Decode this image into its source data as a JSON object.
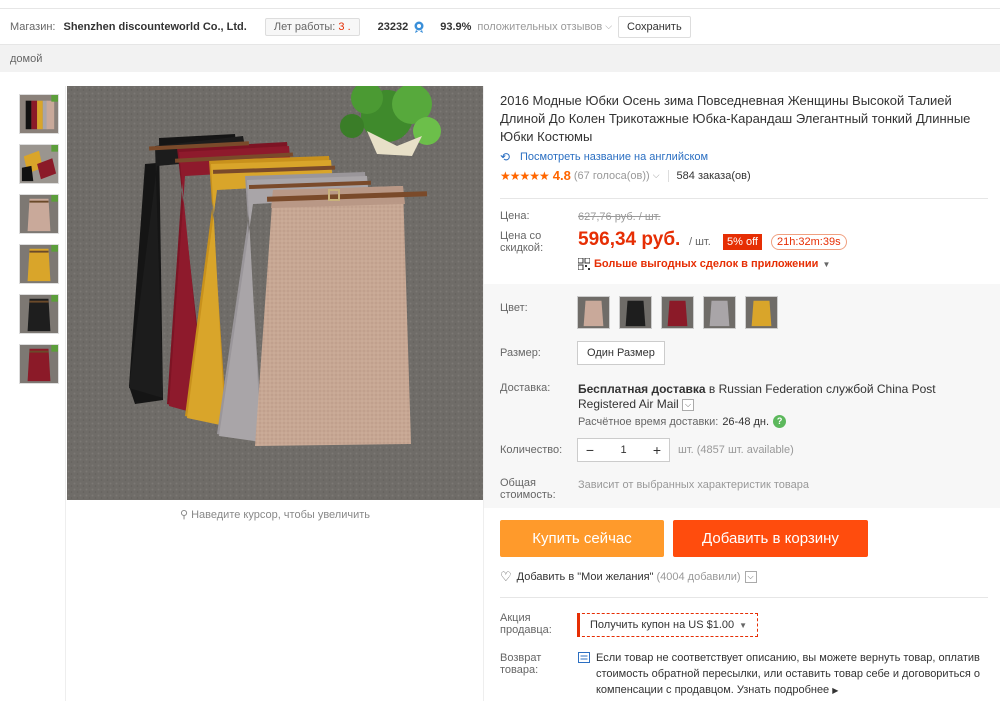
{
  "store": {
    "label": "Магазин:",
    "name": "Shenzhen discounteworld Co., Ltd.",
    "years_label": "Лет работы:",
    "years_value": "3 .",
    "score": "23232",
    "positive_pct": "93.9%",
    "positive_label": "положительных отзывов",
    "save_label": "Сохранить"
  },
  "breadcrumb": {
    "home": "домой"
  },
  "gallery": {
    "zoom_hint": "Наведите курсор, чтобы увеличить",
    "thumb_colors": [
      "#5a3a2a",
      "#c9a84a",
      "#c8ad9a",
      "#d9a52a",
      "#222222",
      "#8b1a28"
    ]
  },
  "product": {
    "title": "2016 Модные Юбки Осень зима Повседневная Женщины Высокой Талией Длиной До Колен Трикотажные Юбка-Карандаш Элегантный тонкий Длинные Юбки Костюмы",
    "english_link": "Посмотреть название на английском",
    "stars": "★★★★★",
    "rating": "4.8",
    "votes": "(67 голоса(ов))",
    "orders": "584 заказа(ов)"
  },
  "price": {
    "label": "Цена:",
    "old": "627,76 руб. / шт.",
    "discount_label": "Цена со скидкой:",
    "new": "596,34 руб.",
    "per_unit": "/ шт.",
    "discount_badge": "5% off",
    "timer": "21h:32m:39s",
    "app_deals": "Больше выгодных сделок в приложении"
  },
  "sku": {
    "color_label": "Цвет:",
    "colors": [
      "#c9a99a",
      "#1e1e1e",
      "#8b1a28",
      "#a9a5a8",
      "#d9a52a"
    ],
    "size_label": "Размер:",
    "size_value": "Один Размер",
    "shipping_label": "Доставка:",
    "shipping_free": "Бесплатная доставка",
    "shipping_to": " в Russian Federation службой China Post Registered Air Mail",
    "eta_label": "Расчётное время доставки:",
    "eta_value": "26-48 дн.",
    "qty_label": "Количество:",
    "qty_value": "1",
    "qty_note": "шт. (4857 шт. available)",
    "total_label": "Общая стоимость:",
    "total_value": "Зависит от выбранных характеристик товара"
  },
  "actions": {
    "buy_now": "Купить сейчас",
    "add_to_cart": "Добавить в корзину",
    "wishlist": "Добавить в \"Мои желания\"",
    "wishlist_count": "(4004 добавили)"
  },
  "promo": {
    "label": "Акция продавца:",
    "coupon_text": "Получить купон на",
    "coupon_value": "US $1.00"
  },
  "returns": {
    "label": "Возврат товара:",
    "text": "Если товар не соответствует описанию, вы можете вернуть товар, оплатив стоимость обратной пересылки, или оставить товар себе и договориться о компенсации с продавцом.",
    "more": "Узнать подробнее"
  }
}
